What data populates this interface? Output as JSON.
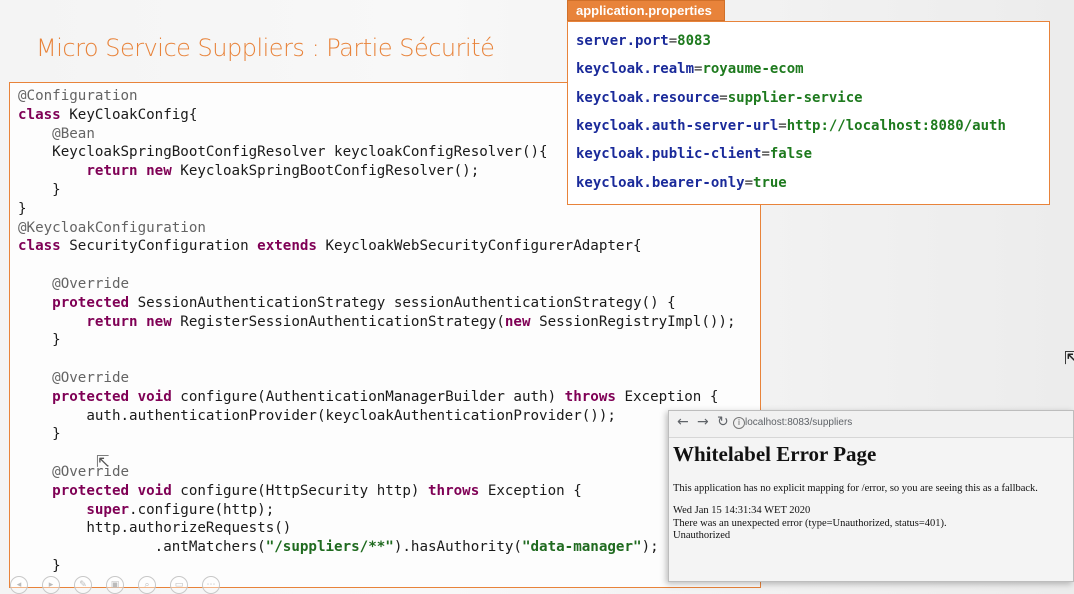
{
  "slide": {
    "title": "Micro Service Suppliers : Partie Sécurité"
  },
  "code": {
    "lines": [
      [
        {
          "c": "an",
          "t": "@Configuration"
        }
      ],
      [
        {
          "c": "kw",
          "t": "class "
        },
        {
          "c": "plain",
          "t": "KeyCloakConfig{"
        }
      ],
      [
        {
          "c": "an",
          "t": "    @Bean"
        }
      ],
      [
        {
          "c": "plain",
          "t": "    KeycloakSpringBootConfigResolver keycloakConfigResolver(){"
        }
      ],
      [
        {
          "c": "kw",
          "t": "        return new "
        },
        {
          "c": "plain",
          "t": "KeycloakSpringBootConfigResolver();"
        }
      ],
      [
        {
          "c": "plain",
          "t": "    }"
        }
      ],
      [
        {
          "c": "plain",
          "t": "}"
        }
      ],
      [
        {
          "c": "an",
          "t": "@KeycloakConfiguration"
        }
      ],
      [
        {
          "c": "kw",
          "t": "class "
        },
        {
          "c": "plain",
          "t": "SecurityConfiguration "
        },
        {
          "c": "kw",
          "t": "extends "
        },
        {
          "c": "plain",
          "t": "KeycloakWebSecurityConfigurerAdapter{"
        }
      ],
      [
        {
          "c": "plain",
          "t": ""
        }
      ],
      [
        {
          "c": "an",
          "t": "    @Override"
        }
      ],
      [
        {
          "c": "kw",
          "t": "    protected "
        },
        {
          "c": "plain",
          "t": "SessionAuthenticationStrategy sessionAuthenticationStrategy() {"
        }
      ],
      [
        {
          "c": "kw",
          "t": "        return new "
        },
        {
          "c": "plain",
          "t": "RegisterSessionAuthenticationStrategy("
        },
        {
          "c": "kw",
          "t": "new "
        },
        {
          "c": "plain",
          "t": "SessionRegistryImpl());"
        }
      ],
      [
        {
          "c": "plain",
          "t": "    }"
        }
      ],
      [
        {
          "c": "plain",
          "t": ""
        }
      ],
      [
        {
          "c": "an",
          "t": "    @Override"
        }
      ],
      [
        {
          "c": "kw",
          "t": "    protected void "
        },
        {
          "c": "plain",
          "t": "configure(AuthenticationManagerBuilder auth) "
        },
        {
          "c": "kw",
          "t": "throws "
        },
        {
          "c": "plain",
          "t": "Exception {"
        }
      ],
      [
        {
          "c": "plain",
          "t": "        auth.authenticationProvider(keycloakAuthenticationProvider());"
        }
      ],
      [
        {
          "c": "plain",
          "t": "    }"
        }
      ],
      [
        {
          "c": "plain",
          "t": ""
        }
      ],
      [
        {
          "c": "an",
          "t": "    @Override"
        }
      ],
      [
        {
          "c": "kw",
          "t": "    protected void "
        },
        {
          "c": "plain",
          "t": "configure(HttpSecurity http) "
        },
        {
          "c": "kw",
          "t": "throws "
        },
        {
          "c": "plain",
          "t": "Exception {"
        }
      ],
      [
        {
          "c": "kw",
          "t": "        super"
        },
        {
          "c": "plain",
          "t": ".configure(http);"
        }
      ],
      [
        {
          "c": "plain",
          "t": "        http.authorizeRequests()"
        }
      ],
      [
        {
          "c": "plain",
          "t": "                .antMatchers("
        },
        {
          "c": "st",
          "t": "\"/suppliers/**\""
        },
        {
          "c": "plain",
          "t": ").hasAuthority("
        },
        {
          "c": "st",
          "t": "\"data-manager\""
        },
        {
          "c": "plain",
          "t": ");"
        }
      ],
      [
        {
          "c": "plain",
          "t": "    }"
        }
      ]
    ]
  },
  "properties": {
    "tab_label": "application.properties",
    "rows": [
      {
        "key": "server.port",
        "eq": "=",
        "val": "8083"
      },
      {
        "key": "keycloak.realm",
        "eq": "=",
        "val": "royaume-ecom"
      },
      {
        "key": "keycloak.resource",
        "eq": "=",
        "val": "supplier-service"
      },
      {
        "key": "keycloak.auth-server-url",
        "eq": "=",
        "val": "http://localhost:8080/auth"
      },
      {
        "key": "keycloak.public-client",
        "eq": "=",
        "val": "false"
      },
      {
        "key": "keycloak.bearer-only",
        "eq": "=",
        "val": "true"
      }
    ]
  },
  "browser": {
    "back": "←",
    "forward": "→",
    "reload": "↻",
    "info": "i",
    "url": "localhost:8083/suppliers",
    "heading": "Whitelabel Error Page",
    "message": "This application has no explicit mapping for /error, so you are seeing this as a fallback.",
    "timestamp": "Wed Jan 15 14:31:34 WET 2020",
    "error": "There was an unexpected error (type=Unauthorized, status=401).",
    "status": "Unauthorized"
  },
  "tools": {
    "icons": [
      "◂",
      "▸",
      "✎",
      "▣",
      "⌕",
      "▭",
      "⋯"
    ]
  }
}
